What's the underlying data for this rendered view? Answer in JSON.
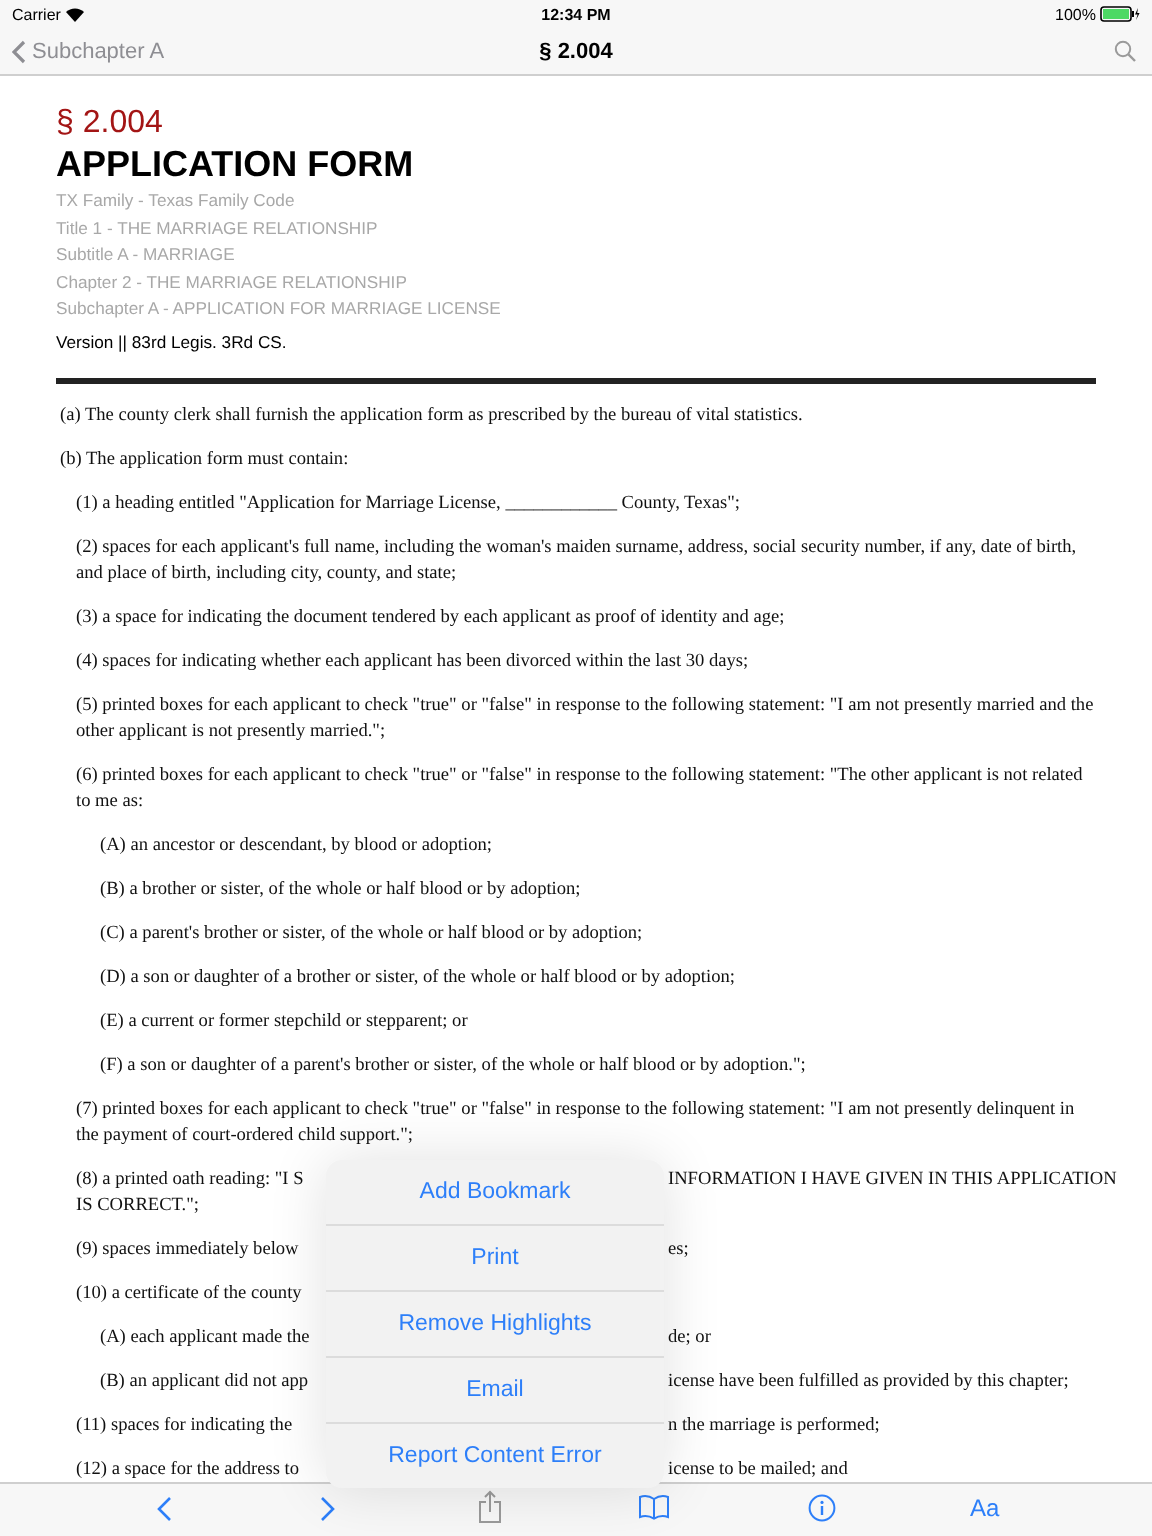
{
  "status_bar": {
    "carrier": "Carrier",
    "time": "12:34 PM",
    "battery": "100%"
  },
  "nav_bar": {
    "back_label": "Subchapter A",
    "title": "§ 2.004"
  },
  "document": {
    "section_number": "§ 2.004",
    "heading": "APPLICATION FORM",
    "breadcrumbs": [
      "TX Family - Texas Family Code",
      "Title 1 - THE MARRIAGE RELATIONSHIP",
      "Subtitle A - MARRIAGE",
      "Chapter 2 - THE MARRIAGE RELATIONSHIP",
      "Subchapter A - APPLICATION FOR MARRIAGE LICENSE"
    ],
    "version": "Version || 83rd Legis. 3Rd CS.",
    "paragraphs": [
      {
        "kind": "full",
        "text": "(a) The county clerk shall furnish the application form as prescribed by the bureau of vital statistics."
      },
      {
        "kind": "full",
        "text": "(b) The application form must contain:",
        "children": [
          {
            "kind": "full",
            "text": "(1) a heading entitled \"Application for Marriage License, ____________ County, Texas\";"
          },
          {
            "kind": "full",
            "text": "(2) spaces for each applicant's full name, including the woman's maiden surname, address, social security number, if any, date of birth, and place of birth, including city, county, and state;"
          },
          {
            "kind": "full",
            "text": "(3) a space for indicating the document tendered by each applicant as proof of identity and age;"
          },
          {
            "kind": "full",
            "text": "(4) spaces for indicating whether each applicant has been divorced within the last 30 days;"
          },
          {
            "kind": "full",
            "text": "(5) printed boxes for each applicant to check \"true\" or \"false\" in response to the following statement: \"I am not presently married and the other applicant is not presently married.\";"
          },
          {
            "kind": "full",
            "text": "(6) printed boxes for each applicant to check \"true\" or \"false\" in response to the following statement: \"The other applicant is not related to me as:",
            "children": [
              {
                "kind": "full",
                "text": "(A) an ancestor or descendant, by blood or adoption;"
              },
              {
                "kind": "full",
                "text": "(B) a brother or sister, of the whole or half blood or by adoption;"
              },
              {
                "kind": "full",
                "text": "(C) a parent's brother or sister, of the whole or half blood or by adoption;"
              },
              {
                "kind": "full",
                "text": "(D) a son or daughter of a brother or sister, of the whole or half blood or by adoption;"
              },
              {
                "kind": "full",
                "text": "(E) a current or former stepchild or stepparent; or"
              },
              {
                "kind": "full",
                "text": "(F) a son or daughter of a parent's brother or sister, of the whole or half blood or by adoption.\";"
              }
            ]
          },
          {
            "kind": "full",
            "text": "(7) printed boxes for each applicant to check \"true\" or \"false\" in response to the following statement: \"I am not presently delinquent in the payment of court-ordered child support.\";"
          },
          {
            "kind": "covered",
            "visible_start": "(8) a printed oath reading: \"I S",
            "visible_end": "INFORMATION I HAVE GIVEN IN THIS APPLICATION",
            "continued": "IS CORRECT.\";"
          },
          {
            "kind": "covered",
            "visible_start": "(9) spaces immediately below",
            "visible_end": "es;"
          },
          {
            "kind": "covered",
            "visible_start": "(10) a certificate of the county",
            "children": [
              {
                "kind": "covered",
                "visible_start": "(A) each applicant made the",
                "visible_end": "de; or"
              },
              {
                "kind": "covered",
                "visible_start": "(B) an applicant did not app",
                "visible_end": "icense have been fulfilled as provided by this chapter;"
              }
            ]
          },
          {
            "kind": "covered",
            "visible_start": "(11) spaces for indicating the",
            "visible_end": "n the marriage is performed;"
          },
          {
            "kind": "covered",
            "visible_start": "(12) a space for the address to",
            "visible_end": "icense to be mailed; and"
          }
        ]
      }
    ]
  },
  "popover_menu": [
    "Add Bookmark",
    "Print",
    "Remove Highlights",
    "Email",
    "Report Content Error"
  ],
  "toolbar": {
    "font_button": "Aa"
  }
}
